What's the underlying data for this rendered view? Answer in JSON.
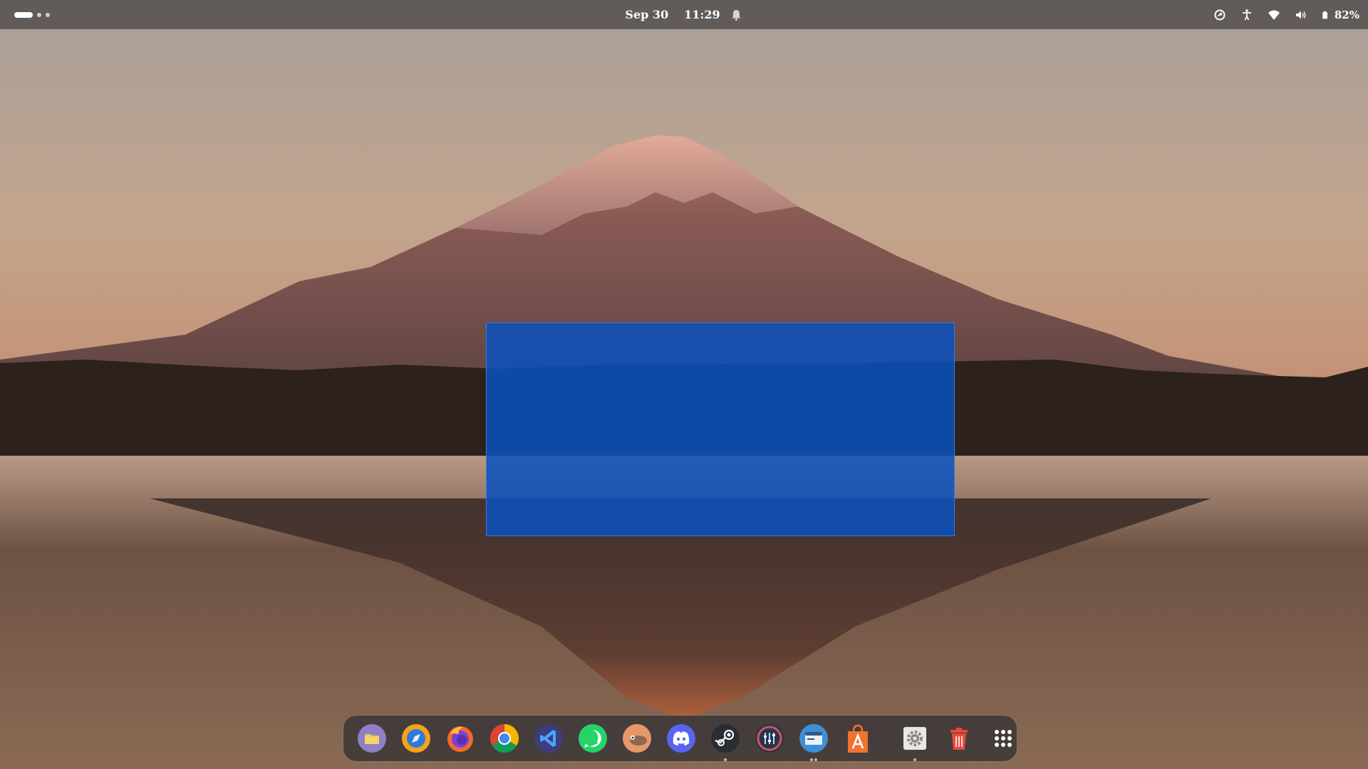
{
  "topbar": {
    "date": "Sep 30",
    "time": "11:29",
    "battery_percent": "82%",
    "icons": [
      "screen-share-icon",
      "accessibility-icon",
      "wifi-icon",
      "volume-icon",
      "battery-icon"
    ]
  },
  "dock": {
    "apps": [
      {
        "name": "files-icon"
      },
      {
        "name": "web-browser-icon"
      },
      {
        "name": "firefox-icon"
      },
      {
        "name": "chrome-icon"
      },
      {
        "name": "vscode-icon"
      },
      {
        "name": "whatsapp-icon"
      },
      {
        "name": "gimp-icon"
      },
      {
        "name": "discord-icon"
      },
      {
        "name": "steam-icon"
      },
      {
        "name": "mixer-icon"
      },
      {
        "name": "window-manager-icon"
      },
      {
        "name": "app-store-icon"
      },
      {
        "name": "settings-icon"
      },
      {
        "name": "trash-icon"
      },
      {
        "name": "show-apps-icon"
      }
    ]
  },
  "colors": {
    "selection": "#0a50be",
    "topbar": "#55504e",
    "dock": "#3c3838"
  }
}
